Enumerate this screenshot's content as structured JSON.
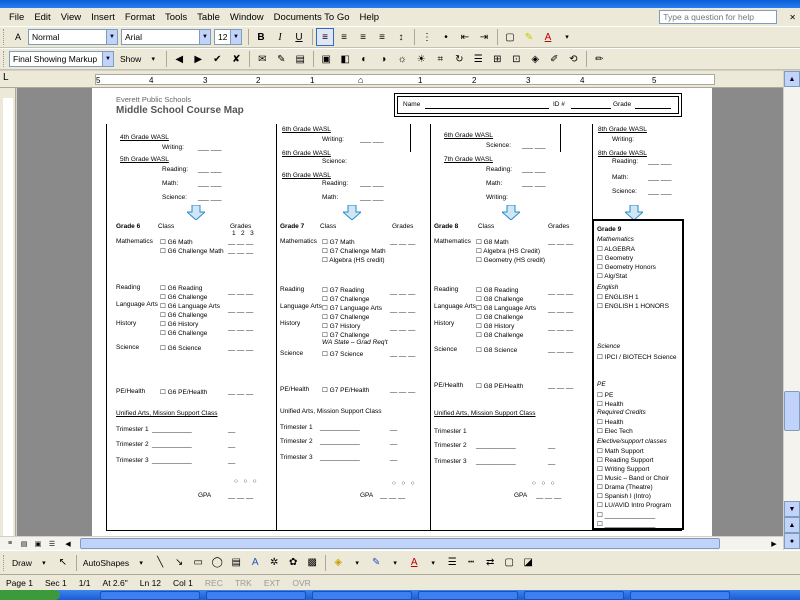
{
  "menubar": {
    "items": [
      "File",
      "Edit",
      "View",
      "Insert",
      "Format",
      "Tools",
      "Table",
      "Window",
      "Documents To Go",
      "Help"
    ],
    "help_placeholder": "Type a question for help"
  },
  "toolbar1": {
    "style": "Normal",
    "font": "Arial",
    "size": "12"
  },
  "toolbar2": {
    "markup": "Final Showing Markup",
    "show_label": "Show"
  },
  "ruler": {
    "numbers": [
      "5",
      "4",
      "3",
      "2",
      "1",
      "1",
      "2",
      "3",
      "4",
      "5"
    ]
  },
  "document": {
    "school": "Everett Public Schools",
    "title": "Middle School Course Map",
    "name_label": "Name",
    "id_label": "ID #",
    "grade_label": "Grade",
    "col1_top": {
      "g4_wasl": "4th Grade WASL",
      "writing": "Writing:",
      "g5_wasl": "5th Grade WASL",
      "reading": "Reading:",
      "math": "Math:",
      "science": "Science:"
    },
    "col2_top": {
      "wasl": "6th Grade WASL",
      "writing": "Writing:",
      "g6_wasl": "6th Grade WASL",
      "science": "Science:",
      "g6_wasl2": "6th Grade WASL",
      "reading": "Reading:",
      "math": "Math:"
    },
    "col3_top": {
      "g7_wasl": "6th Grade WASL",
      "science": "Science:",
      "g7_wasl2": "7th Grade WASL",
      "reading": "Reading:",
      "math": "Math:",
      "writing": "Writing:"
    },
    "col4_top": {
      "wasl": "8th Grade WASL",
      "writing": "Writing:",
      "g8_wasl": "8th Grade WASL",
      "reading": "Reading:",
      "math": "Math:",
      "science": "Science:"
    },
    "grade6": {
      "header": "Grade 6",
      "class_label": "Class",
      "grades_label": "Grades",
      "trim_nums": [
        "1",
        "2",
        "3"
      ],
      "math_label": "Mathematics",
      "math_classes": [
        "G6 Math",
        "G6 Challenge Math"
      ],
      "reading_label": "Reading",
      "lang_label": "Language Arts",
      "history_label": "History",
      "rl_classes": [
        "G6 Reading",
        "G6 Challenge",
        "G6 Language Arts",
        "G6 Challenge",
        "G6 History",
        "G6 Challenge"
      ],
      "science_label": "Science",
      "science_class": "G6 Science",
      "pe_label": "PE/Health",
      "pe_class": "G6 PE/Health",
      "unified": "Unified Arts, Mission Support Class",
      "trimesters": [
        "Trimester 1",
        "Trimester 2",
        "Trimester 3"
      ],
      "gpa": "GPA"
    },
    "grade7": {
      "header": "Grade 7",
      "class_label": "Class",
      "grades_label": "Grades",
      "math_label": "Mathematics",
      "math_classes": [
        "G7 Math",
        "G7 Challenge Math",
        "Algebra (HS credit)"
      ],
      "reading_label": "Reading",
      "lang_label": "Language Arts",
      "history_label": "History",
      "rl_classes": [
        "G7 Reading",
        "G7 Challenge",
        "G7 Language Arts",
        "G7 Challenge",
        "G7 History",
        "G7 Challenge"
      ],
      "wa_state": "WA State – Grad Req't",
      "science_label": "Science",
      "science_class": "G7 Science",
      "pe_label": "PE/Health",
      "pe_class": "G7 PE/Health",
      "unified": "Unified Arts, Mission Support Class",
      "trimesters": [
        "Trimester 1",
        "Trimester 2",
        "Trimester 3"
      ],
      "gpa": "GPA"
    },
    "grade8": {
      "header": "Grade 8",
      "class_label": "Class",
      "grades_label": "Grades",
      "math_label": "Mathematics",
      "math_classes": [
        "G8 Math",
        "Algebra (HS Credit)",
        "Geometry (HS credit)"
      ],
      "reading_label": "Reading",
      "lang_label": "Language Arts",
      "history_label": "History",
      "rl_classes": [
        "G8 Reading",
        "G8 Challenge",
        "G8 Language Arts",
        "G8 Challenge",
        "G8 History",
        "G8 Challenge"
      ],
      "science_label": "Science",
      "science_class": "G8 Science",
      "pe_label": "PE/Health",
      "pe_class": "G8 PE/Health",
      "unified": "Unified Arts, Mission Support Class",
      "trimesters": [
        "Trimester 1",
        "Trimester 2",
        "Trimester 3"
      ],
      "gpa": "GPA"
    },
    "grade9": {
      "header": "Grade 9",
      "math_label": "Mathematics",
      "math_classes": [
        "ALGEBRA",
        "Geometry",
        "Geometry Honors",
        "Alg/Stat"
      ],
      "english_label": "English",
      "english_classes": [
        "ENGLISH 1",
        "ENGLISH 1 HONORS"
      ],
      "science_label": "Science",
      "science_class": "IPCI / BIOTECH Science",
      "pe_label": "PE",
      "pe_classes": [
        "PE",
        "Health"
      ],
      "req_label": "Required Credits",
      "req_classes": [
        "Health",
        "Elec Tech"
      ],
      "elective_label": "Elective/support classes",
      "elective_classes": [
        "Math Support",
        "Reading Support",
        "Writing Support",
        "Music – Band or Choir",
        "Drama (Theatre)",
        "Spanish I (Intro)",
        "LU/AVID Intro Program"
      ]
    }
  },
  "drawbar": {
    "draw_label": "Draw",
    "autoshapes_label": "AutoShapes"
  },
  "status": {
    "page": "Page  1",
    "sec": "Sec  1",
    "pages": "1/1",
    "at": "At  2.6\"",
    "ln": "Ln  12",
    "col": "Col  1",
    "rec": "REC",
    "trk": "TRK",
    "ext": "EXT",
    "ovr": "OVR"
  }
}
